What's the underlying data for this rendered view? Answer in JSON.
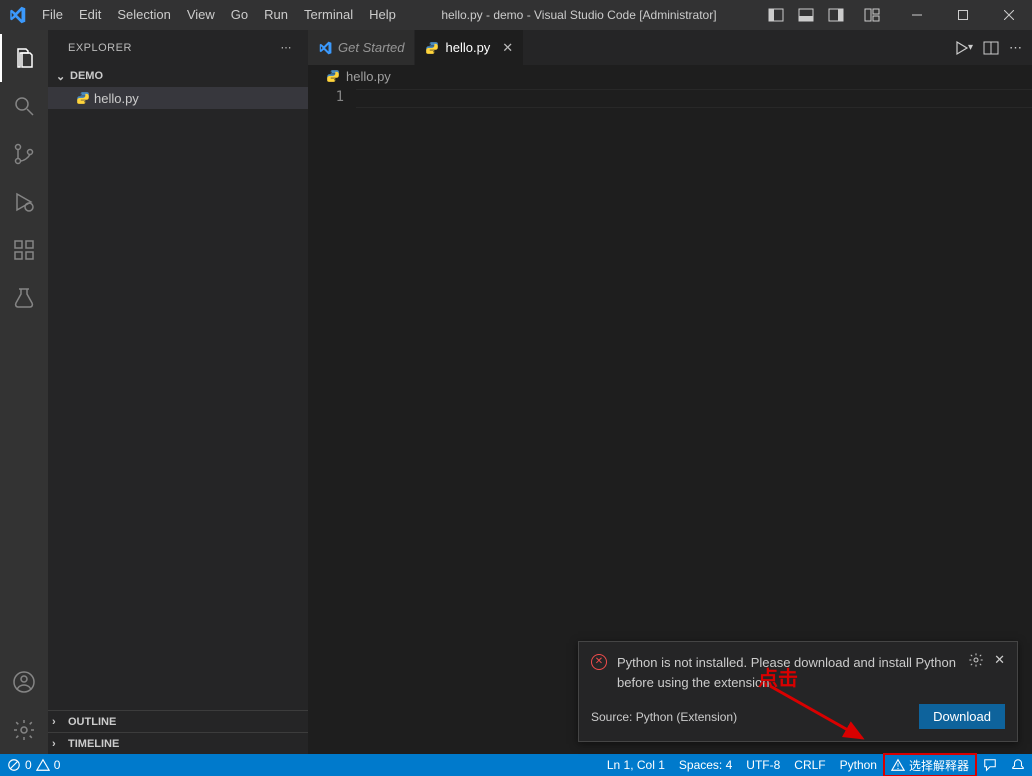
{
  "title": "hello.py - demo - Visual Studio Code [Administrator]",
  "menu": [
    "File",
    "Edit",
    "Selection",
    "View",
    "Go",
    "Run",
    "Terminal",
    "Help"
  ],
  "sidebar": {
    "title": "EXPLORER",
    "root": "DEMO",
    "file": "hello.py",
    "outline": "OUTLINE",
    "timeline": "TIMELINE"
  },
  "tabs": {
    "get_started": "Get Started",
    "active": "hello.py"
  },
  "breadcrumb": "hello.py",
  "gutter_line": "1",
  "status": {
    "errors": "0",
    "warnings": "0",
    "ln_col": "Ln 1, Col 1",
    "spaces": "Spaces: 4",
    "encoding": "UTF-8",
    "eol": "CRLF",
    "lang": "Python",
    "interpreter": "选择解释器"
  },
  "notification": {
    "message": "Python is not installed. Please download and install Python before using the extension.",
    "source": "Source: Python (Extension)",
    "button": "Download"
  },
  "annotation": "点击"
}
